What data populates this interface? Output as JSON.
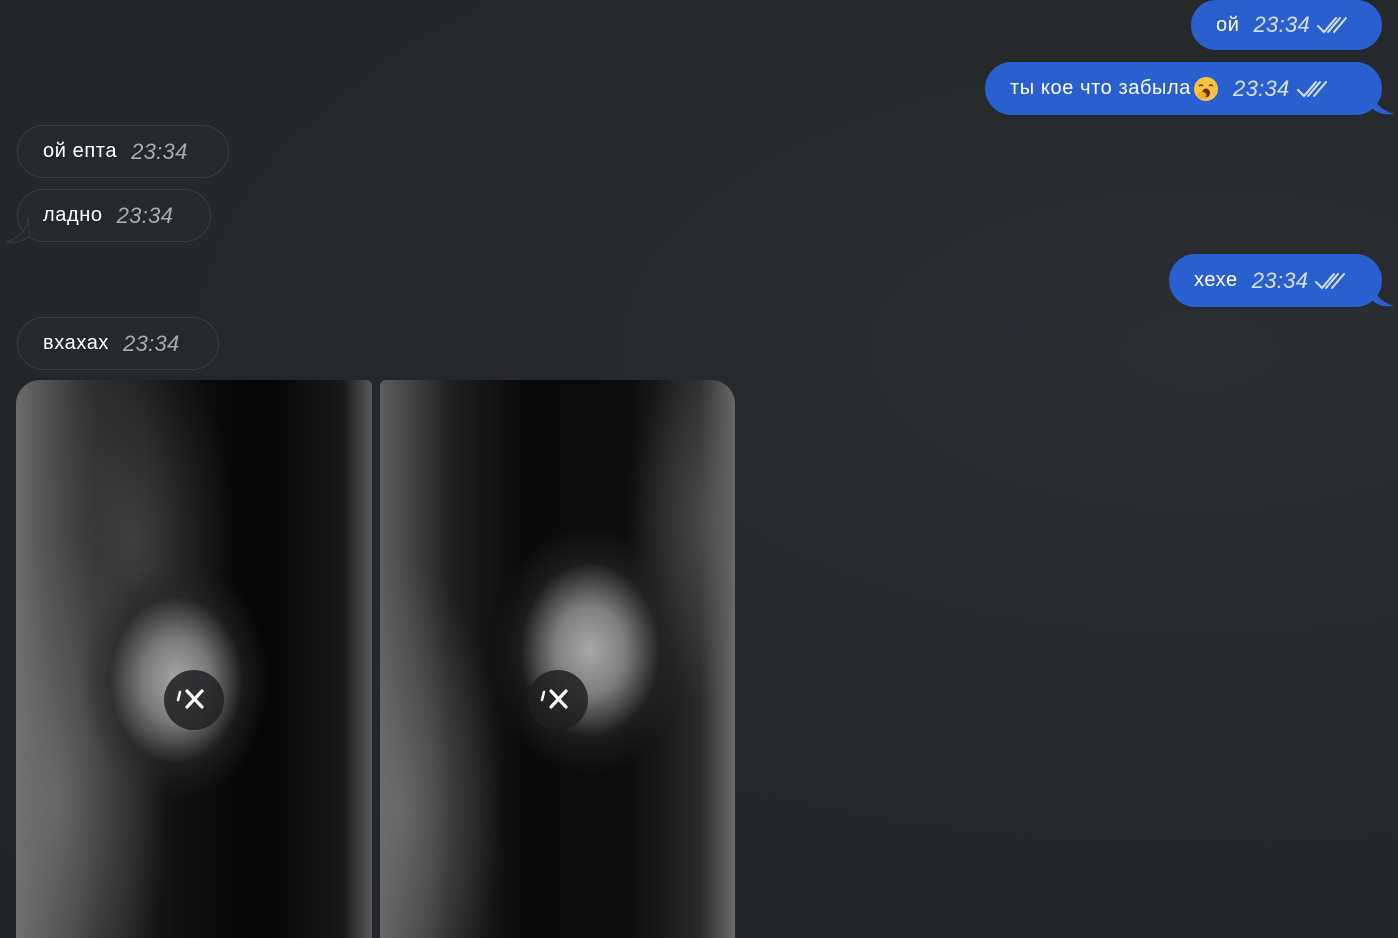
{
  "messages": [
    {
      "id": "m1",
      "direction": "out",
      "text": "ой",
      "time": "23:34",
      "status": "read"
    },
    {
      "id": "m2",
      "direction": "out",
      "text": "ты кое что забыла",
      "emoji": "yawning-face-icon",
      "time": "23:34",
      "status": "read"
    },
    {
      "id": "m3",
      "direction": "in",
      "text": "ой епта",
      "time": "23:34"
    },
    {
      "id": "m4",
      "direction": "in",
      "text": "ладно",
      "time": "23:34"
    },
    {
      "id": "m5",
      "direction": "out",
      "text": "хехе",
      "time": "23:34",
      "status": "read"
    },
    {
      "id": "m6",
      "direction": "in",
      "text": "вхахах",
      "time": "23:34"
    }
  ],
  "media": [
    {
      "id": "photo-1",
      "state": "blurred-not-downloaded",
      "action_icon": "cancel-download-icon"
    },
    {
      "id": "photo-2",
      "state": "blurred-not-downloaded",
      "action_icon": "cancel-download-icon"
    }
  ],
  "colors": {
    "background": "#24272a",
    "outgoing_bubble": "#2a5fcf",
    "incoming_bubble": "#26292c",
    "incoming_border": "#3a3d41"
  }
}
